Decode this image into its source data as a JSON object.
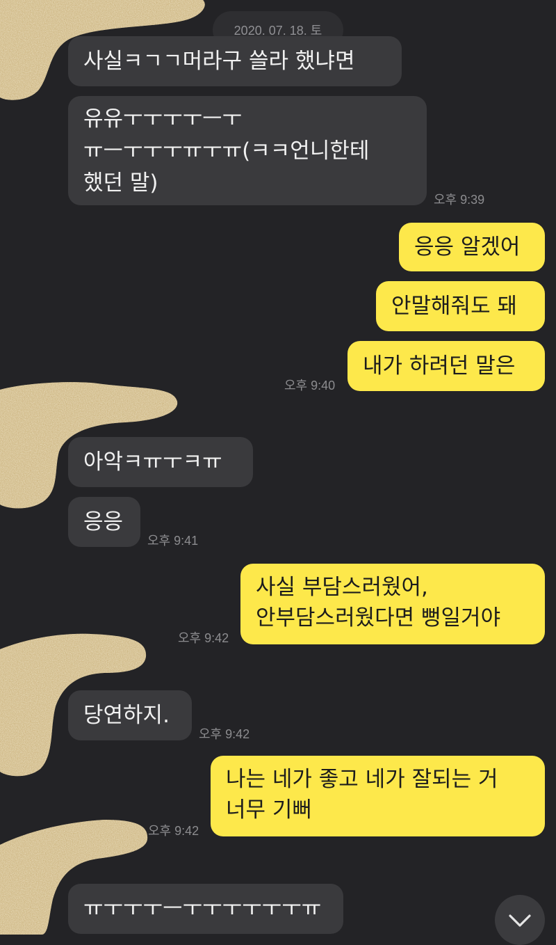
{
  "chat": {
    "date_divider": "2020. 07. 18. 토",
    "messages": [
      {
        "side": "in",
        "text": "사실ㅋㄱㄱ머라구 쓸라 했냐면"
      },
      {
        "side": "in",
        "text": "유유ㅜㅜㅜㅜㅡㅜ\nㅠㅡㅜㅜㅜㅠㅜㅠ(ㅋㅋ언니한테\n했던 말)",
        "time": "오후 9:39"
      },
      {
        "side": "out",
        "text": "응응 알겠어"
      },
      {
        "side": "out",
        "text": "안말해줘도 돼"
      },
      {
        "side": "out",
        "text": "내가 하려던 말은",
        "time": "오후 9:40"
      },
      {
        "side": "in",
        "text": "아악ㅋㅠㅜㅋㅠ"
      },
      {
        "side": "in",
        "text": "응응",
        "time": "오후 9:41"
      },
      {
        "side": "out",
        "text": "사실 부담스러웠어,\n안부담스러웠다면 뻥일거야",
        "time": "오후 9:42"
      },
      {
        "side": "in",
        "text": "당연하지.",
        "time": "오후 9:42"
      },
      {
        "side": "out",
        "text": "나는 네가 좋고 네가 잘되는 거\n너무 기뻐",
        "time": "오후 9:42"
      },
      {
        "side": "in",
        "text": "ㅠㅜㅜㅜㅡㅜㅜㅜㅜㅜㅜㅠ"
      }
    ]
  },
  "ui": {
    "scroll_down_icon": "chevron-down-icon",
    "avatar_placeholder": "blurred-gold-glitter",
    "colors": {
      "background": "#232326",
      "incoming_bubble": "#3a3a3d",
      "outgoing_bubble": "#fde84b",
      "timestamp": "#8c8c8f",
      "blur_gold": "#c9b07a"
    }
  }
}
